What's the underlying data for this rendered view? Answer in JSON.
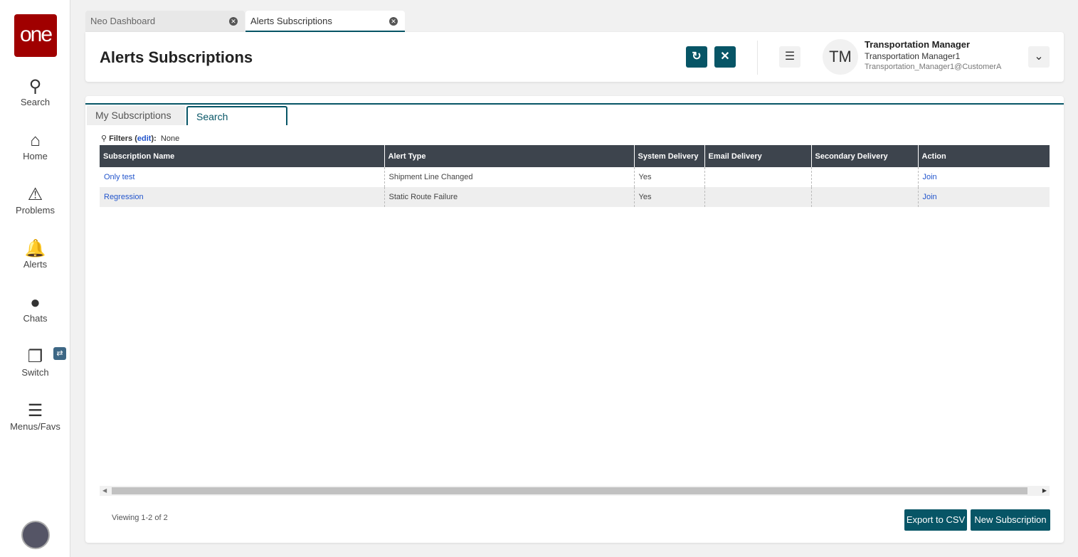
{
  "sidebar": {
    "logo": "one",
    "items": [
      {
        "label": "Search"
      },
      {
        "label": "Home"
      },
      {
        "label": "Problems"
      },
      {
        "label": "Alerts"
      },
      {
        "label": "Chats"
      },
      {
        "label": "Switch"
      },
      {
        "label": "Menus/Favs"
      }
    ]
  },
  "tabs": [
    {
      "label": "Neo Dashboard"
    },
    {
      "label": "Alerts Subscriptions"
    }
  ],
  "header": {
    "title": "Alerts Subscriptions",
    "user": {
      "initials": "TM",
      "name": "Transportation Manager",
      "role": "Transportation Manager1",
      "account": "Transportation_Manager1@CustomerA"
    }
  },
  "subtabs": [
    {
      "label": "My Subscriptions"
    },
    {
      "label": "Search"
    }
  ],
  "filters": {
    "label": "Filters",
    "edit": "edit",
    "value": "None"
  },
  "table": {
    "columns": [
      "Subscription Name",
      "Alert Type",
      "System Delivery",
      "Email Delivery",
      "Secondary Delivery",
      "Action"
    ],
    "rows": [
      [
        "Only test",
        "Shipment Line Changed",
        "Yes",
        "",
        "",
        "Join"
      ],
      [
        "Regression",
        "Static Route Failure",
        "Yes",
        "",
        "",
        "Join"
      ]
    ]
  },
  "footer": {
    "viewing": "Viewing 1-2 of 2",
    "export": "Export to CSV",
    "new": "New Subscription"
  },
  "colors": {
    "accent": "#075566",
    "brand": "#a00000"
  }
}
